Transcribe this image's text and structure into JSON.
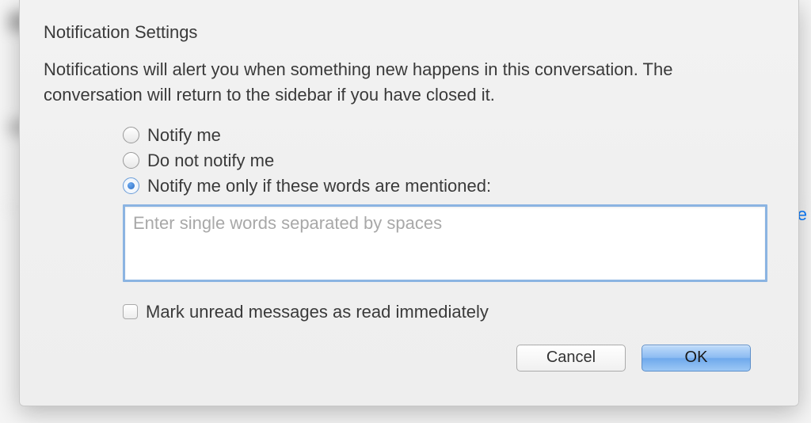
{
  "dialog": {
    "title": "Notification Settings",
    "description": "Notifications will alert you when something new happens in this conversation. The conversation will return to the sidebar if you have closed it.",
    "options": {
      "notify": "Notify me",
      "do_not_notify": "Do not notify me",
      "notify_if_words": "Notify me only if these words are mentioned:"
    },
    "words_input": {
      "placeholder": "Enter single words separated by spaces",
      "value": ""
    },
    "checkbox": {
      "mark_read": "Mark unread messages as read immediately"
    },
    "buttons": {
      "cancel": "Cancel",
      "ok": "OK"
    }
  },
  "background": {
    "right_text": "Ye"
  }
}
